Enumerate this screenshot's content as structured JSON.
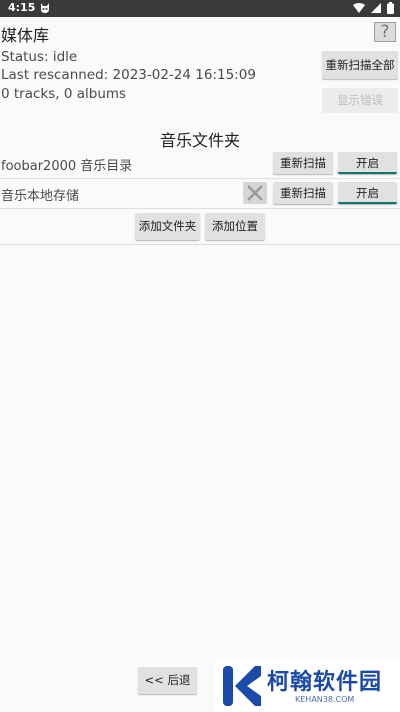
{
  "status_bar": {
    "time": "4:15"
  },
  "header": {
    "title": "媒体库",
    "help_label": "?"
  },
  "library": {
    "status": "Status: idle",
    "last_rescanned": "Last rescanned: 2023-02-24 16:15:09",
    "summary": "0 tracks, 0 albums"
  },
  "actions": {
    "rescan_all": "重新扫描全部",
    "show_errors": "显示错误"
  },
  "folders_section": {
    "title": "音乐文件夹",
    "items": [
      {
        "name": "foobar2000 音乐目录",
        "rescan": "重新扫描",
        "toggle": "开启",
        "removable": false
      },
      {
        "name": "音乐本地存储",
        "rescan": "重新扫描",
        "toggle": "开启",
        "removable": true
      }
    ],
    "add_folder": "添加文件夹",
    "add_location": "添加位置"
  },
  "footer": {
    "back": "<< 后退"
  },
  "watermark": {
    "name": "柯翰软件园",
    "url": "KEHAN38.COM"
  },
  "colors": {
    "accent": "#0b766b",
    "status_bar": "#3a3a3a",
    "watermark_blue": "#1b4aa8"
  }
}
